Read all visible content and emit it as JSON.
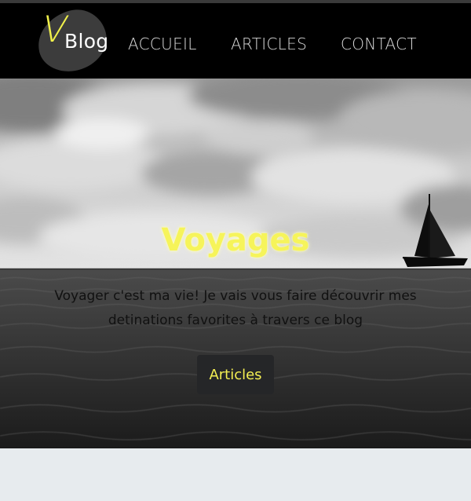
{
  "logo": {
    "letter": "V",
    "text": "Blog"
  },
  "nav": {
    "items": [
      {
        "label": "ACCUEIL"
      },
      {
        "label": "ARTICLES"
      },
      {
        "label": "CONTACT"
      }
    ]
  },
  "hero": {
    "title": "Voyages",
    "subtitle": "Voyager c'est ma vie! Je vais vous faire découvrir mes detinations favorites à travers ce blog",
    "button_label": "Articles"
  },
  "colors": {
    "accent": "#f4ef52",
    "navbar": "#000000",
    "button_bg": "#252628",
    "page_bg": "#e7ebee"
  }
}
